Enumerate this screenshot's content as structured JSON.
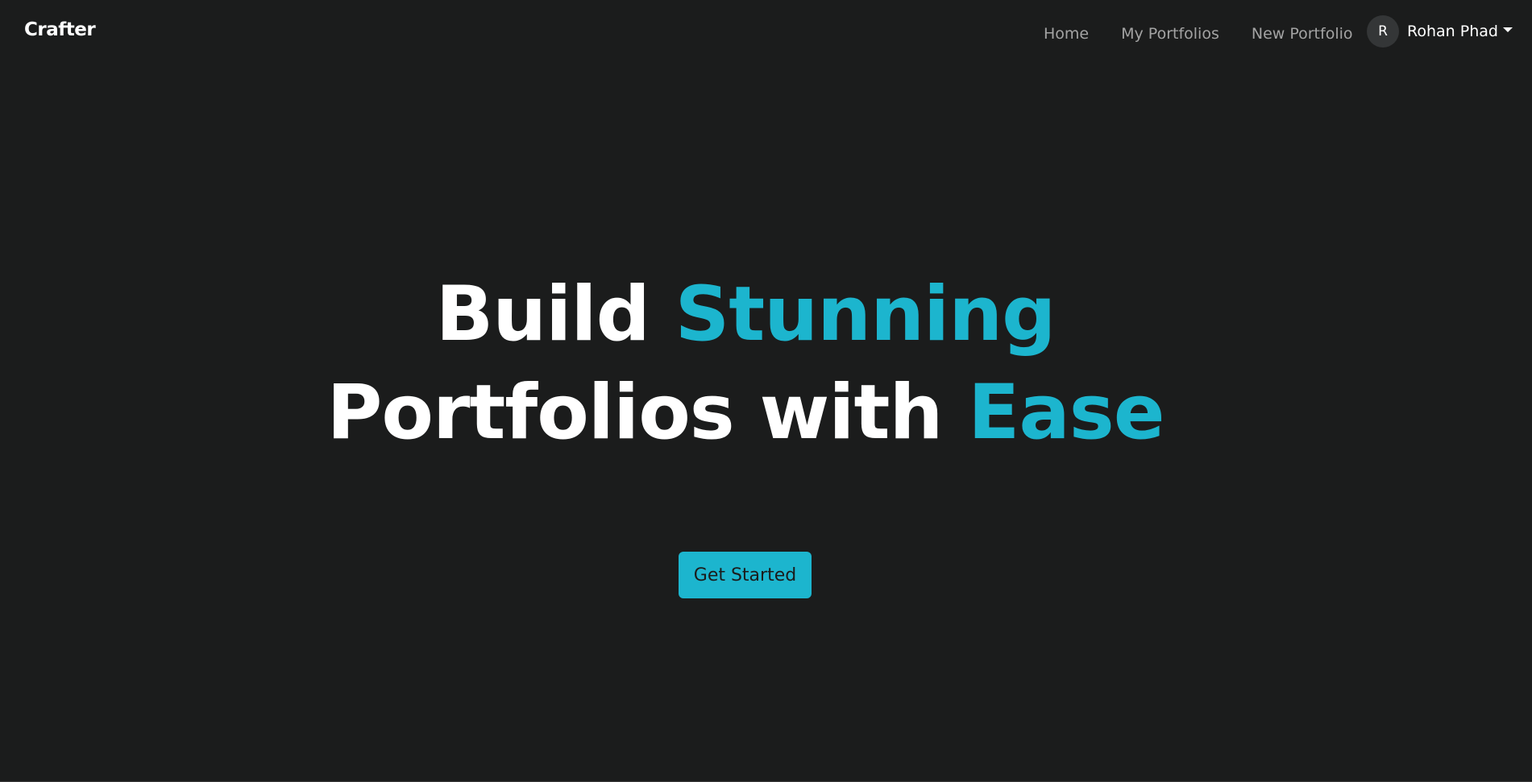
{
  "navbar": {
    "brand": "Crafter",
    "links": [
      {
        "label": "Home"
      },
      {
        "label": "My Portfolios"
      },
      {
        "label": "New Portfolio"
      }
    ],
    "user": {
      "avatar_initial": "R",
      "name": "Rohan Phad",
      "dropdown_icon": "caret-down-icon"
    }
  },
  "hero": {
    "line1_plain": "Build ",
    "line1_accent": "Stunning",
    "line2_plain": "Portfolios with ",
    "line2_accent": "Ease",
    "cta_label": "Get Started"
  },
  "colors": {
    "background": "#1b1c1c",
    "accent": "#1cb5ce",
    "text": "#ffffff",
    "nav_muted": "#a3a3a3",
    "avatar_bg": "#343637"
  }
}
